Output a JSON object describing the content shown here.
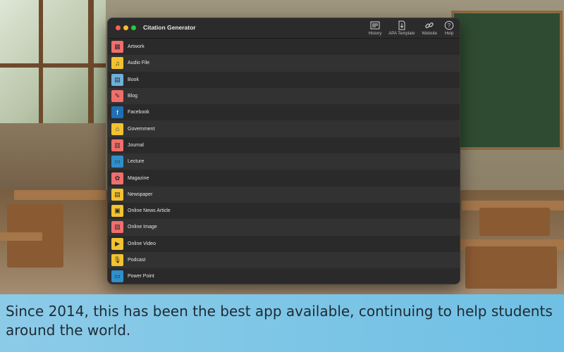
{
  "window": {
    "title": "Citation Generator"
  },
  "toolbar": {
    "history": "History",
    "apa_template": "APA Template",
    "website": "Website",
    "help": "Help"
  },
  "sources": [
    {
      "label": "Artwork",
      "color": "#ef6f6c",
      "icon": "artwork-icon",
      "glyph": "▦"
    },
    {
      "label": "Audio File",
      "color": "#f2c230",
      "icon": "audio-file-icon",
      "glyph": "♫"
    },
    {
      "label": "Book",
      "color": "#6eb0d8",
      "icon": "book-icon",
      "glyph": "▤"
    },
    {
      "label": "Blog",
      "color": "#ef6f6c",
      "icon": "blog-icon",
      "glyph": "✎"
    },
    {
      "label": "Facebook",
      "color": "#1f6fb2",
      "icon": "facebook-icon",
      "glyph": "f"
    },
    {
      "label": "Government",
      "color": "#f2c230",
      "icon": "government-icon",
      "glyph": "⌂"
    },
    {
      "label": "Journal",
      "color": "#ef6f6c",
      "icon": "journal-icon",
      "glyph": "▥"
    },
    {
      "label": "Lecture",
      "color": "#2f8fc9",
      "icon": "lecture-icon",
      "glyph": "▭"
    },
    {
      "label": "Magazine",
      "color": "#ef6f6c",
      "icon": "magazine-icon",
      "glyph": "✿"
    },
    {
      "label": "Newspaper",
      "color": "#f2c230",
      "icon": "newspaper-icon",
      "glyph": "▤"
    },
    {
      "label": "Online News Article",
      "color": "#f2c230",
      "icon": "online-news-article-icon",
      "glyph": "▣"
    },
    {
      "label": "Online Image",
      "color": "#ef6f6c",
      "icon": "online-image-icon",
      "glyph": "▨"
    },
    {
      "label": "Online Video",
      "color": "#f2c230",
      "icon": "online-video-icon",
      "glyph": "▶"
    },
    {
      "label": "Podcast",
      "color": "#f2c230",
      "icon": "podcast-icon",
      "glyph": "🎙"
    },
    {
      "label": "Power Point",
      "color": "#2f8fc9",
      "icon": "power-point-icon",
      "glyph": "▭"
    }
  ],
  "caption": "Since 2014, this has been the best app available, continuing to help students around the world."
}
